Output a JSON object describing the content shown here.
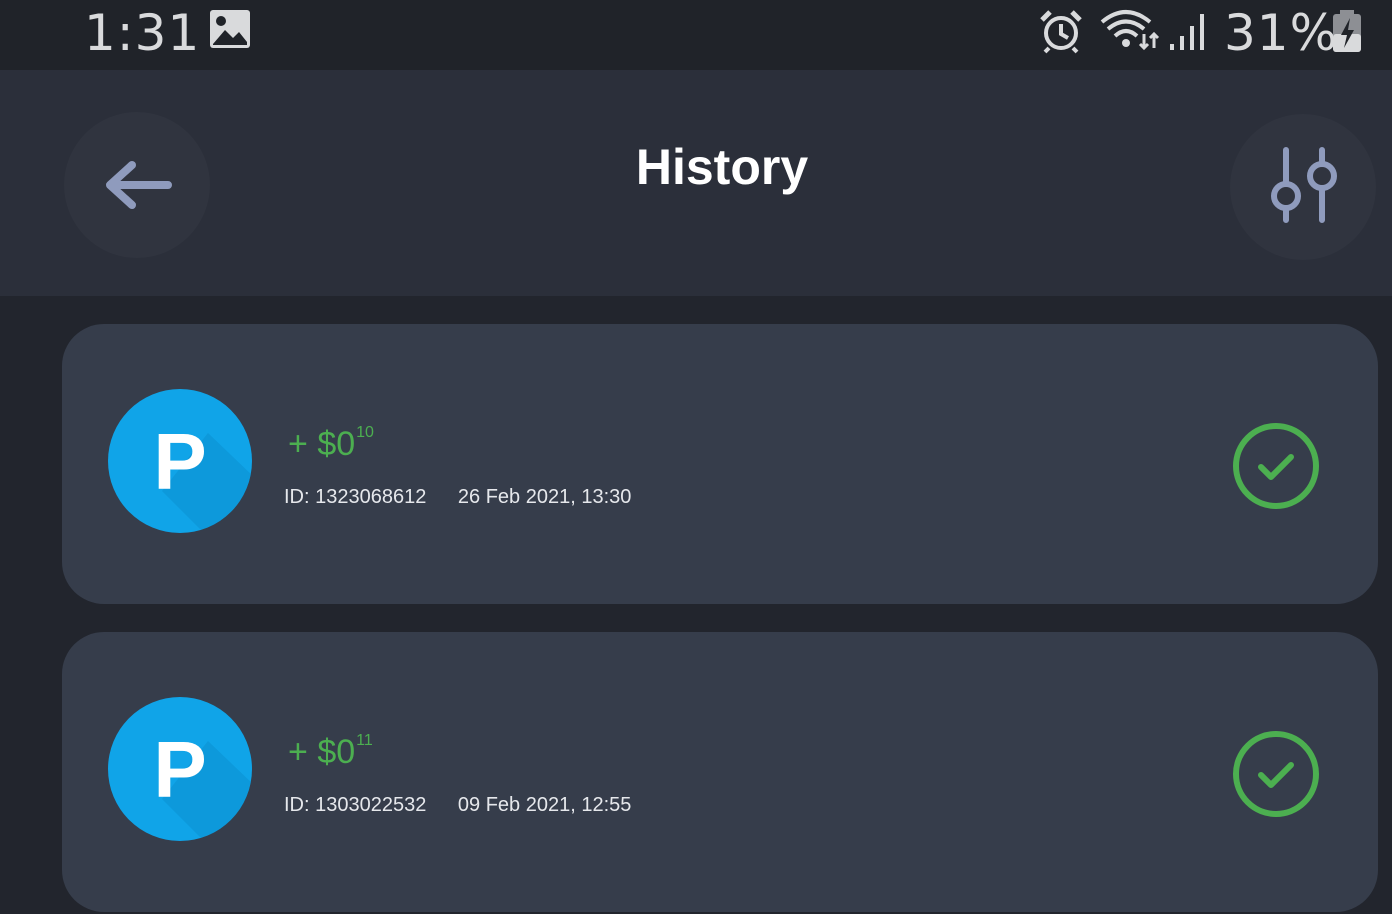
{
  "status_bar": {
    "time": "1:31",
    "battery": "31%",
    "icons": [
      "gallery-icon",
      "alarm-icon",
      "wifi-icon",
      "signal-icon",
      "battery-charging-icon"
    ]
  },
  "header": {
    "title": "History",
    "back_icon": "arrow-left-icon",
    "filter_icon": "sliders-icon"
  },
  "transactions": [
    {
      "sign": "+",
      "currency": "$",
      "whole": "0",
      "cents": "10",
      "id_label": "ID: 1323068612",
      "date": "26 Feb 2021, 13:30",
      "avatar_letter": "P",
      "status": "completed"
    },
    {
      "sign": "+",
      "currency": "$",
      "whole": "0",
      "cents": "11",
      "id_label": "ID: 1303022532",
      "date": "09 Feb 2021, 12:55",
      "avatar_letter": "P",
      "status": "completed"
    }
  ],
  "colors": {
    "background": "#22252d",
    "header": "#2b2f3a",
    "card": "#363d4b",
    "accent_green": "#4caf50",
    "avatar_blue": "#10a4e8"
  }
}
